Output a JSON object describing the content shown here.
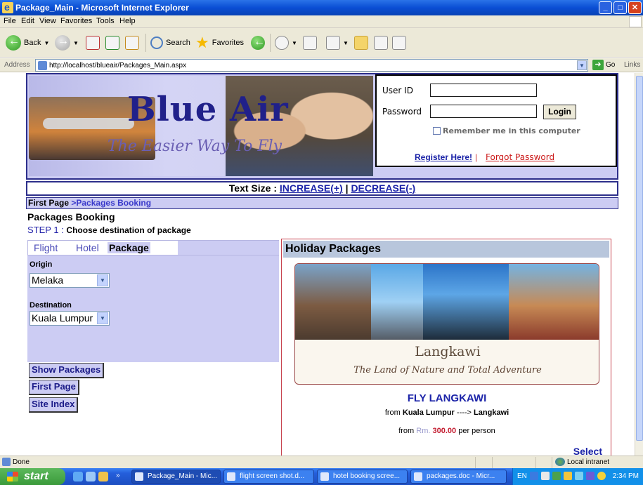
{
  "window": {
    "title": "Package_Main - Microsoft Internet Explorer"
  },
  "menu": [
    "File",
    "Edit",
    "View",
    "Favorites",
    "Tools",
    "Help"
  ],
  "toolbar": {
    "back": "Back",
    "search": "Search",
    "favorites": "Favorites"
  },
  "address": {
    "label": "Address",
    "url": "http://localhost/blueair/Packages_Main.aspx",
    "go": "Go",
    "links": "Links"
  },
  "banner": {
    "title": "Blue Air",
    "tagline": "The Easier Way To Fly"
  },
  "login": {
    "user_label": "User ID",
    "password_label": "Password",
    "button": "Login",
    "remember": "Remember me in this computer",
    "register": "Register Here!",
    "separator": "|",
    "forgot": "Forgot Password"
  },
  "textsize": {
    "label": "Text Size  : ",
    "increase": "INCREASE(+)",
    "sep": " | ",
    "decrease": "DECREASE(-)"
  },
  "breadcrumb": {
    "first": "First Page",
    "current": ">Packages Booking"
  },
  "page": {
    "title": "Packages Booking",
    "step_num": "STEP 1",
    "step_sep": " : ",
    "step_text": "Choose destination of package"
  },
  "tabs": [
    {
      "label": "Flight"
    },
    {
      "label": "Hotel"
    },
    {
      "label": "Package"
    }
  ],
  "form": {
    "origin_label": "Origin",
    "origin_value": "Melaka",
    "destination_label": "Destination",
    "destination_value": "Kuala Lumpur"
  },
  "nav_buttons": {
    "show": "Show Packages",
    "first": "First Page",
    "index": "Site Index"
  },
  "holiday": {
    "header": "Holiday Packages",
    "place": "Langkawi",
    "slogan": "The Land of Nature and Total Adventure",
    "fly": "FLY LANGKAWI",
    "from_word": "from",
    "origin": "Kuala Lumpur",
    "arrow": "---->",
    "destination": "Langkawi",
    "price_from": "from",
    "currency": "Rm.",
    "price": "300.00",
    "per": "per person",
    "select": "Select"
  },
  "status": {
    "text": "Done",
    "zone": "Local intranet"
  },
  "taskbar": {
    "start": "start",
    "tasks": [
      {
        "label": "Package_Main - Mic..."
      },
      {
        "label": "flight screen shot.d..."
      },
      {
        "label": "hotel booking scree..."
      },
      {
        "label": "packages.doc - Micr..."
      }
    ],
    "lang": "EN",
    "clock": "2:34 PM"
  },
  "colors": {
    "brand_navy": "#2d2f8b",
    "panel_lavender": "#ccccf3",
    "link_blue": "#1b23a8",
    "price_red": "#c31b2f"
  }
}
